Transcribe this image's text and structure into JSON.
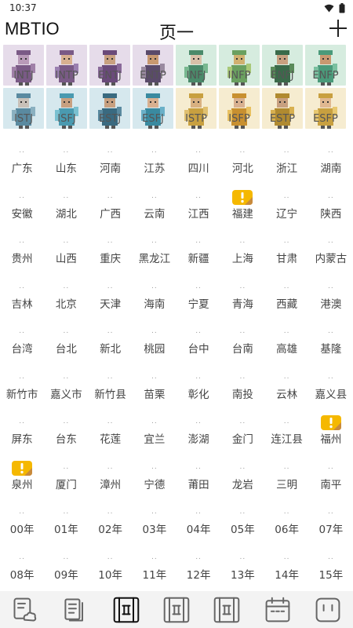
{
  "status": {
    "time": "10:37"
  },
  "app": {
    "title": "MBTIO",
    "page_title": "页一"
  },
  "mbti": [
    {
      "label": "INTJ",
      "bg": "#e6dcea",
      "skin": "#b89ab8",
      "fig": "#7a5a86",
      "accent": "#a080a8"
    },
    {
      "label": "INTP",
      "bg": "#e6dcea",
      "skin": "#d8b090",
      "fig": "#7a5a86",
      "accent": "#9a7fb0"
    },
    {
      "label": "ENTJ",
      "bg": "#e6dcea",
      "skin": "#c8a080",
      "fig": "#6a4a7a",
      "accent": "#8a6a9a"
    },
    {
      "label": "ENTP",
      "bg": "#e6dcea",
      "skin": "#c89870",
      "fig": "#5a4a6a",
      "accent": "#9a8aa0"
    },
    {
      "label": "INFJ",
      "bg": "#d6ecdf",
      "skin": "#d8c0a8",
      "fig": "#4a8a6a",
      "accent": "#78b890"
    },
    {
      "label": "INFP",
      "bg": "#d6ecdf",
      "skin": "#d0b070",
      "fig": "#6aa060",
      "accent": "#a8c878"
    },
    {
      "label": "ENFJ",
      "bg": "#d6ecdf",
      "skin": "#c8a080",
      "fig": "#3a6a4a",
      "accent": "#5a8a5a"
    },
    {
      "label": "ENFP",
      "bg": "#d6ecdf",
      "skin": "#c89870",
      "fig": "#4a9a7a",
      "accent": "#7ac0a0"
    },
    {
      "label": "ISTJ",
      "bg": "#d6e8ee",
      "skin": "#c8c0b8",
      "fig": "#5a8aa0",
      "accent": "#8ab0c0"
    },
    {
      "label": "ISFJ",
      "bg": "#d6e8ee",
      "skin": "#c8a080",
      "fig": "#4a9ab0",
      "accent": "#7ac0d0"
    },
    {
      "label": "ESTJ",
      "bg": "#d6e8ee",
      "skin": "#c8a080",
      "fig": "#3a6a80",
      "accent": "#5a8aa0"
    },
    {
      "label": "ESFJ",
      "bg": "#d6e8ee",
      "skin": "#d8b090",
      "fig": "#3a8aa0",
      "accent": "#6ab0c8"
    },
    {
      "label": "ISTP",
      "bg": "#f6ecd0",
      "skin": "#d8b080",
      "fig": "#c8a040",
      "accent": "#e0c070"
    },
    {
      "label": "ISFP",
      "bg": "#f6ecd0",
      "skin": "#d8b090",
      "fig": "#c89030",
      "accent": "#e8c060"
    },
    {
      "label": "ESTP",
      "bg": "#f6ecd0",
      "skin": "#c8a080",
      "fig": "#b08a30",
      "accent": "#d8b050"
    },
    {
      "label": "ESFP",
      "bg": "#f6ecd0",
      "skin": "#e0b890",
      "fig": "#c8a040",
      "accent": "#e8c870"
    }
  ],
  "cities": [
    {
      "name": "广东"
    },
    {
      "name": "山东"
    },
    {
      "name": "河南"
    },
    {
      "name": "江苏"
    },
    {
      "name": "四川"
    },
    {
      "name": "河北"
    },
    {
      "name": "浙江"
    },
    {
      "name": "湖南"
    },
    {
      "name": "安徽"
    },
    {
      "name": "湖北"
    },
    {
      "name": "广西"
    },
    {
      "name": "云南"
    },
    {
      "name": "江西"
    },
    {
      "name": "福建",
      "badge": true
    },
    {
      "name": "辽宁"
    },
    {
      "name": "陕西"
    },
    {
      "name": "贵州"
    },
    {
      "name": "山西"
    },
    {
      "name": "重庆"
    },
    {
      "name": "黑龙江"
    },
    {
      "name": "新疆"
    },
    {
      "name": "上海"
    },
    {
      "name": "甘肃"
    },
    {
      "name": "内蒙古"
    },
    {
      "name": "吉林"
    },
    {
      "name": "北京"
    },
    {
      "name": "天津"
    },
    {
      "name": "海南"
    },
    {
      "name": "宁夏"
    },
    {
      "name": "青海"
    },
    {
      "name": "西藏"
    },
    {
      "name": "港澳"
    },
    {
      "name": "台湾"
    },
    {
      "name": "台北"
    },
    {
      "name": "新北"
    },
    {
      "name": "桃园"
    },
    {
      "name": "台中"
    },
    {
      "name": "台南"
    },
    {
      "name": "高雄"
    },
    {
      "name": "基隆"
    },
    {
      "name": "新竹市"
    },
    {
      "name": "嘉义市"
    },
    {
      "name": "新竹县"
    },
    {
      "name": "苗栗"
    },
    {
      "name": "彰化"
    },
    {
      "name": "南投"
    },
    {
      "name": "云林"
    },
    {
      "name": "嘉义县"
    },
    {
      "name": "屏东"
    },
    {
      "name": "台东"
    },
    {
      "name": "花莲"
    },
    {
      "name": "宜兰"
    },
    {
      "name": "澎湖"
    },
    {
      "name": "金门"
    },
    {
      "name": "连江县"
    },
    {
      "name": "福州",
      "badge": true
    },
    {
      "name": "泉州",
      "badge": true
    },
    {
      "name": "厦门"
    },
    {
      "name": "漳州"
    },
    {
      "name": "宁德"
    },
    {
      "name": "莆田"
    },
    {
      "name": "龙岩"
    },
    {
      "name": "三明"
    },
    {
      "name": "南平"
    },
    {
      "name": "00年"
    },
    {
      "name": "01年"
    },
    {
      "name": "02年"
    },
    {
      "name": "03年"
    },
    {
      "name": "04年"
    },
    {
      "name": "05年"
    },
    {
      "name": "06年"
    },
    {
      "name": "07年"
    },
    {
      "name": "08年"
    },
    {
      "name": "09年"
    },
    {
      "name": "10年"
    },
    {
      "name": "11年"
    },
    {
      "name": "12年"
    },
    {
      "name": "13年"
    },
    {
      "name": "14年"
    },
    {
      "name": "15年"
    }
  ],
  "city_dots": "..",
  "badge_colors": {
    "left": "#f5b800",
    "right": "#c88a3c",
    "mark": "#ffffff"
  },
  "bottom_nav": [
    {
      "icon": "document-cloud-icon",
      "active": false
    },
    {
      "icon": "documents-icon",
      "active": false
    },
    {
      "icon": "grid-page-icon",
      "active": true
    },
    {
      "icon": "grid-page-icon",
      "active": false
    },
    {
      "icon": "grid-page-icon",
      "active": false
    },
    {
      "icon": "calendar-icon",
      "active": false
    },
    {
      "icon": "face-icon",
      "active": false
    }
  ],
  "nav_colors": {
    "active": "#111111",
    "inactive": "#666666"
  }
}
